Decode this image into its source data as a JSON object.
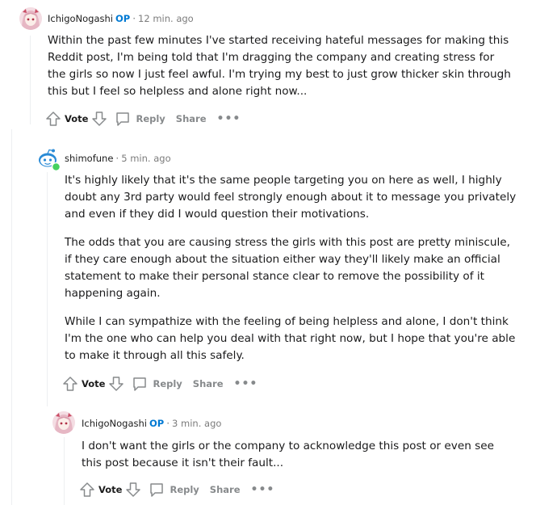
{
  "comments": [
    {
      "author": "IchigoNogashi",
      "op_badge": "OP",
      "separator": "·",
      "time": "12 min. ago",
      "paragraphs": [
        "Within the past few minutes I've started receiving hateful messages for making this Reddit post, I'm being told that I'm dragging the company and creating stress for the girls so now I just feel awful. I'm trying my best to just grow thicker skin through this but I feel so helpless and alone right now..."
      ],
      "actions": {
        "vote": "Vote",
        "reply": "Reply",
        "share": "Share",
        "more": "•••"
      }
    },
    {
      "author": "shimofune",
      "separator": "·",
      "time": "5 min. ago",
      "paragraphs": [
        "It's highly likely that it's the same people targeting you on here as well, I highly doubt any 3rd party would feel strongly enough about it to message you privately and even if they did I would question their motivations.",
        "The odds that you are causing stress the girls with this post are pretty miniscule, if they care enough about the situation either way they'll likely make an official statement to make their personal stance clear to remove the possibility of it happening again.",
        "While I can sympathize with the feeling of being helpless and alone, I don't think I'm the one who can help you deal with that right now, but I hope that you're able to make it through all this safely."
      ],
      "actions": {
        "vote": "Vote",
        "reply": "Reply",
        "share": "Share",
        "more": "•••"
      }
    },
    {
      "author": "IchigoNogashi",
      "op_badge": "OP",
      "separator": "·",
      "time": "3 min. ago",
      "paragraphs": [
        "I don't want the girls or the company to acknowledge this post or even see this post because it isn't their fault..."
      ],
      "actions": {
        "vote": "Vote",
        "reply": "Reply",
        "share": "Share",
        "more": "•••"
      }
    }
  ],
  "colors": {
    "op": "#0079d3",
    "meta": "#7c7c7c",
    "action": "#878a8c",
    "online": "#46d160",
    "thread": "#edeff1"
  },
  "icons": [
    "upvote-icon",
    "downvote-icon",
    "comment-icon",
    "more-icon",
    "anime-avatar-icon",
    "snoo-avatar-icon"
  ]
}
